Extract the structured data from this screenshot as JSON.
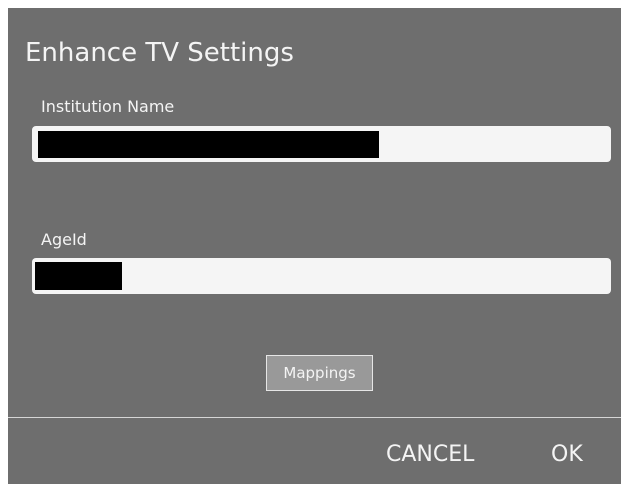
{
  "dialog": {
    "title": "Enhance TV Settings",
    "fields": {
      "institution": {
        "label": "Institution Name"
      },
      "ageid": {
        "label": "AgeId"
      }
    },
    "mappings_label": "Mappings",
    "actions": {
      "cancel_label": "CANCEL",
      "ok_label": "OK"
    }
  },
  "colors": {
    "dialog_background": "#6e6e6e",
    "text": "#f4f4f4",
    "field_background": "#f5f5f5",
    "button_background": "#999999"
  }
}
